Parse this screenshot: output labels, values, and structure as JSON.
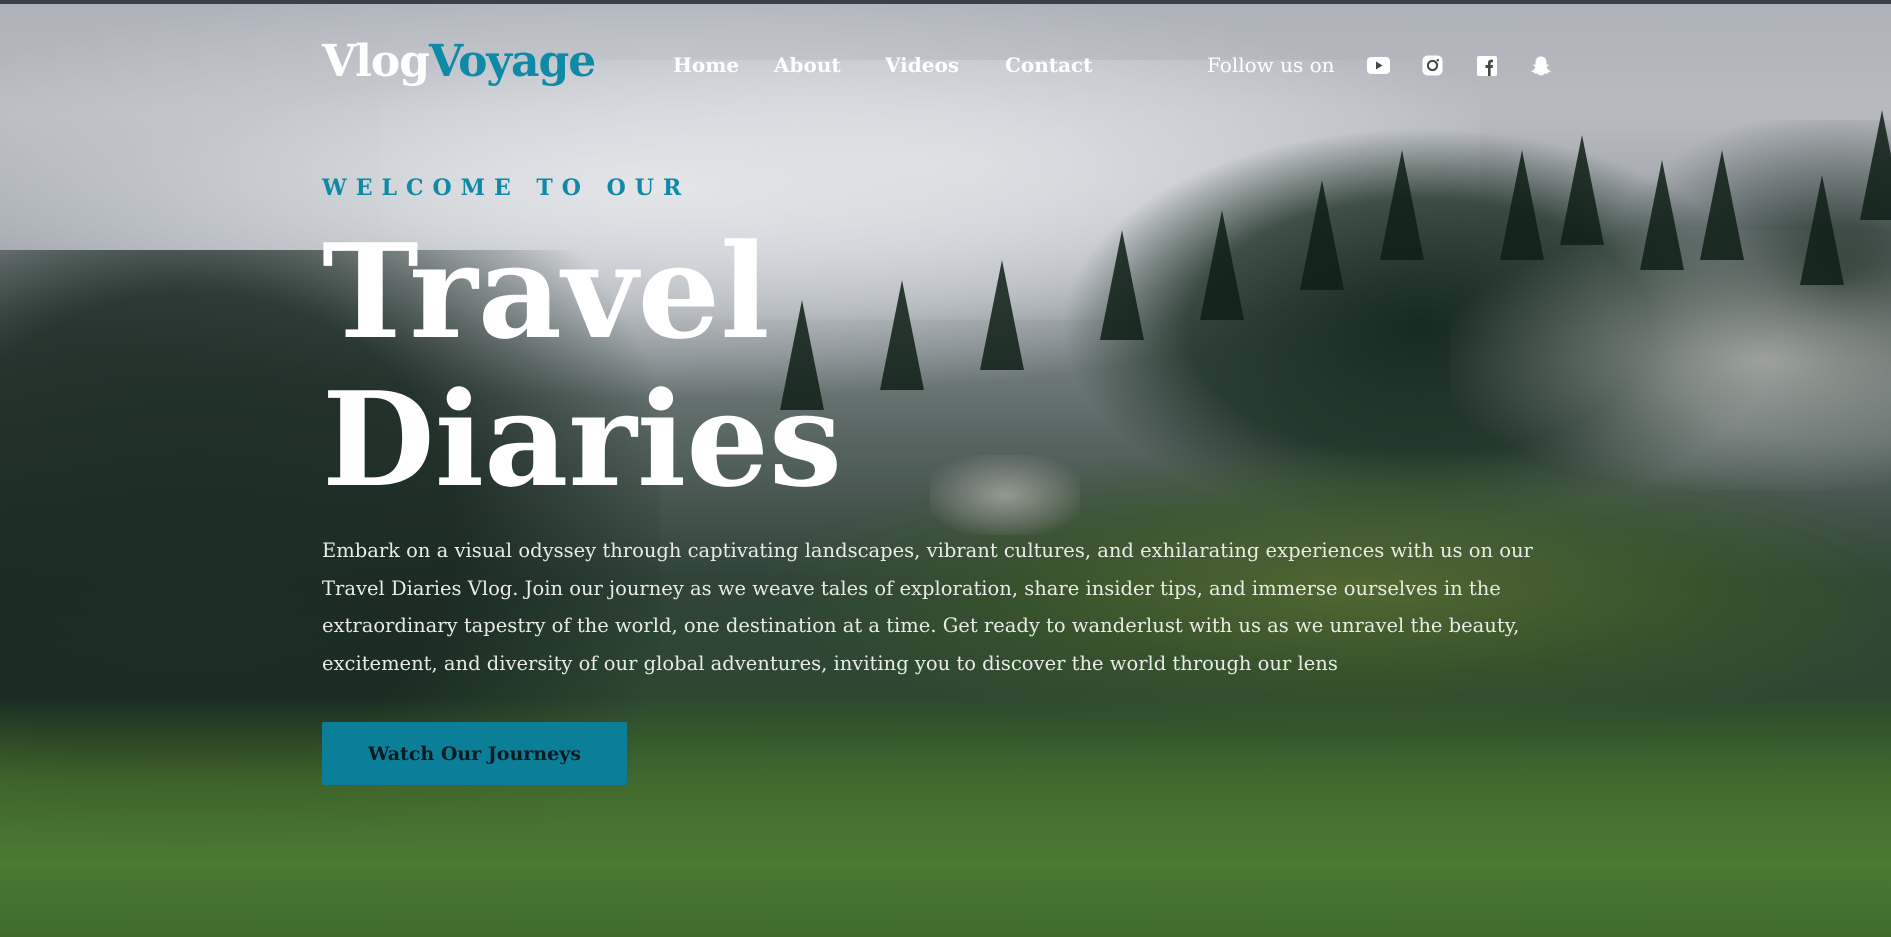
{
  "header": {
    "logo": {
      "part1": "Vlog",
      "part2": "Voyage"
    },
    "nav": [
      {
        "label": "Home"
      },
      {
        "label": "About"
      },
      {
        "label": "Videos"
      },
      {
        "label": "Contact"
      }
    ],
    "follow_label": "Follow us on",
    "social_icons": [
      "youtube-icon",
      "instagram-icon",
      "facebook-icon",
      "snapchat-icon"
    ]
  },
  "hero": {
    "eyebrow": "WELCOME TO OUR",
    "title_line1": "Travel",
    "title_line2": "Diaries",
    "description": "Embark on a visual odyssey through captivating landscapes, vibrant cultures, and exhilarating experiences with us on our Travel Diaries Vlog. Join our journey as we weave tales of exploration, share insider tips, and immerse ourselves in the extraordinary tapestry of the world, one destination at a time. Get ready to wanderlust with us as we unravel the beauty, excitement, and diversity of our global adventures, inviting you to discover the world through our lens",
    "cta_label": "Watch Our Journeys"
  },
  "colors": {
    "accent": "#0e89a6",
    "button": "#0b7f98",
    "text": "#ffffff"
  }
}
